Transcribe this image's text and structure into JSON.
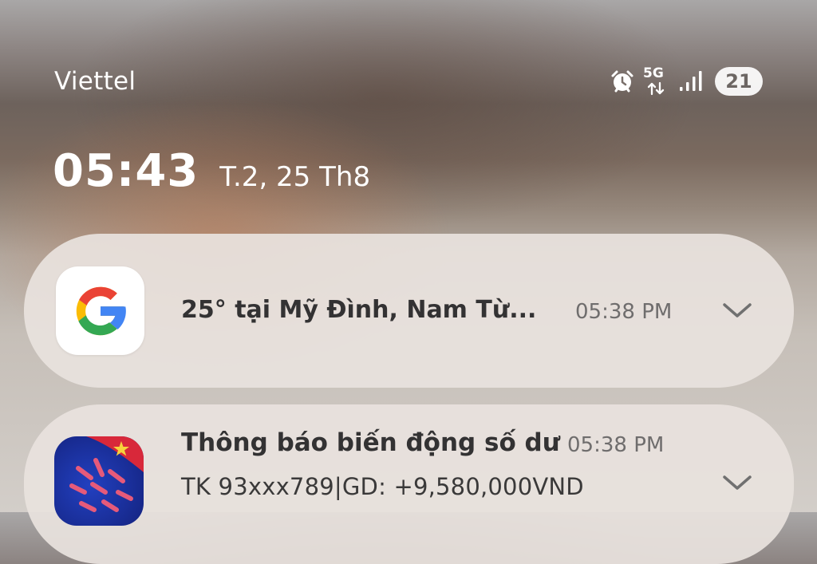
{
  "status_bar": {
    "carrier": "Viettel",
    "network": "5G",
    "battery": "21"
  },
  "lockscreen": {
    "time": "05:43",
    "date": "T.2, 25 Th8"
  },
  "notifications": [
    {
      "app_icon": "google-icon",
      "title": "25° tại Mỹ Đình, Nam Từ...",
      "time": "05:38 PM"
    },
    {
      "app_icon": "bank-app-icon",
      "title": "Thông báo biến động số dư",
      "time": "05:38 PM",
      "body": "TK 93xxx789|GD: +9,580,000VND"
    }
  ],
  "colors": {
    "card_bg": "#e8e2de",
    "text_dark": "#333233",
    "text_muted": "#6f6d6d",
    "bank_icon_blue": "#1a2f9a",
    "bank_icon_red": "#d8283a"
  }
}
